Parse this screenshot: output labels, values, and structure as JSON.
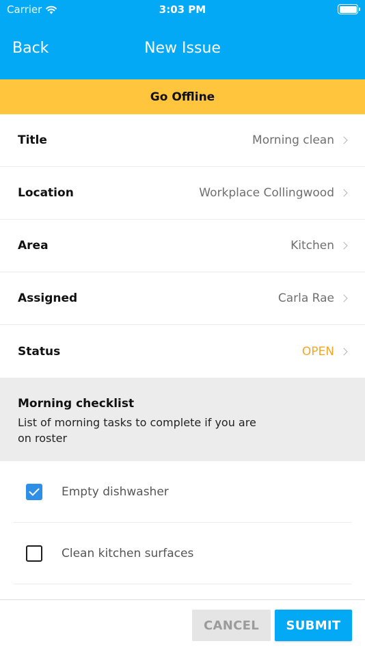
{
  "status_bar": {
    "carrier": "Carrier",
    "time": "3:03 PM"
  },
  "nav": {
    "back_label": "Back",
    "title": "New Issue"
  },
  "banner": {
    "label": "Go Offline"
  },
  "form": {
    "rows": [
      {
        "label": "Title",
        "value": "Morning clean"
      },
      {
        "label": "Location",
        "value": "Workplace Collingwood"
      },
      {
        "label": "Area",
        "value": "Kitchen"
      },
      {
        "label": "Assigned",
        "value": "Carla Rae"
      },
      {
        "label": "Status",
        "value": "OPEN"
      }
    ]
  },
  "checklist": {
    "title": "Morning checklist",
    "description": "List of morning tasks to complete if you are on roster",
    "items": [
      {
        "label": "Empty dishwasher",
        "checked": true
      },
      {
        "label": "Clean kitchen surfaces",
        "checked": false
      }
    ]
  },
  "footer": {
    "cancel_label": "CANCEL",
    "submit_label": "SUBMIT"
  },
  "colors": {
    "primary": "#03a9f4",
    "banner": "#ffc53d",
    "status_open": "#f5a623",
    "checkbox": "#2f8fe6"
  }
}
